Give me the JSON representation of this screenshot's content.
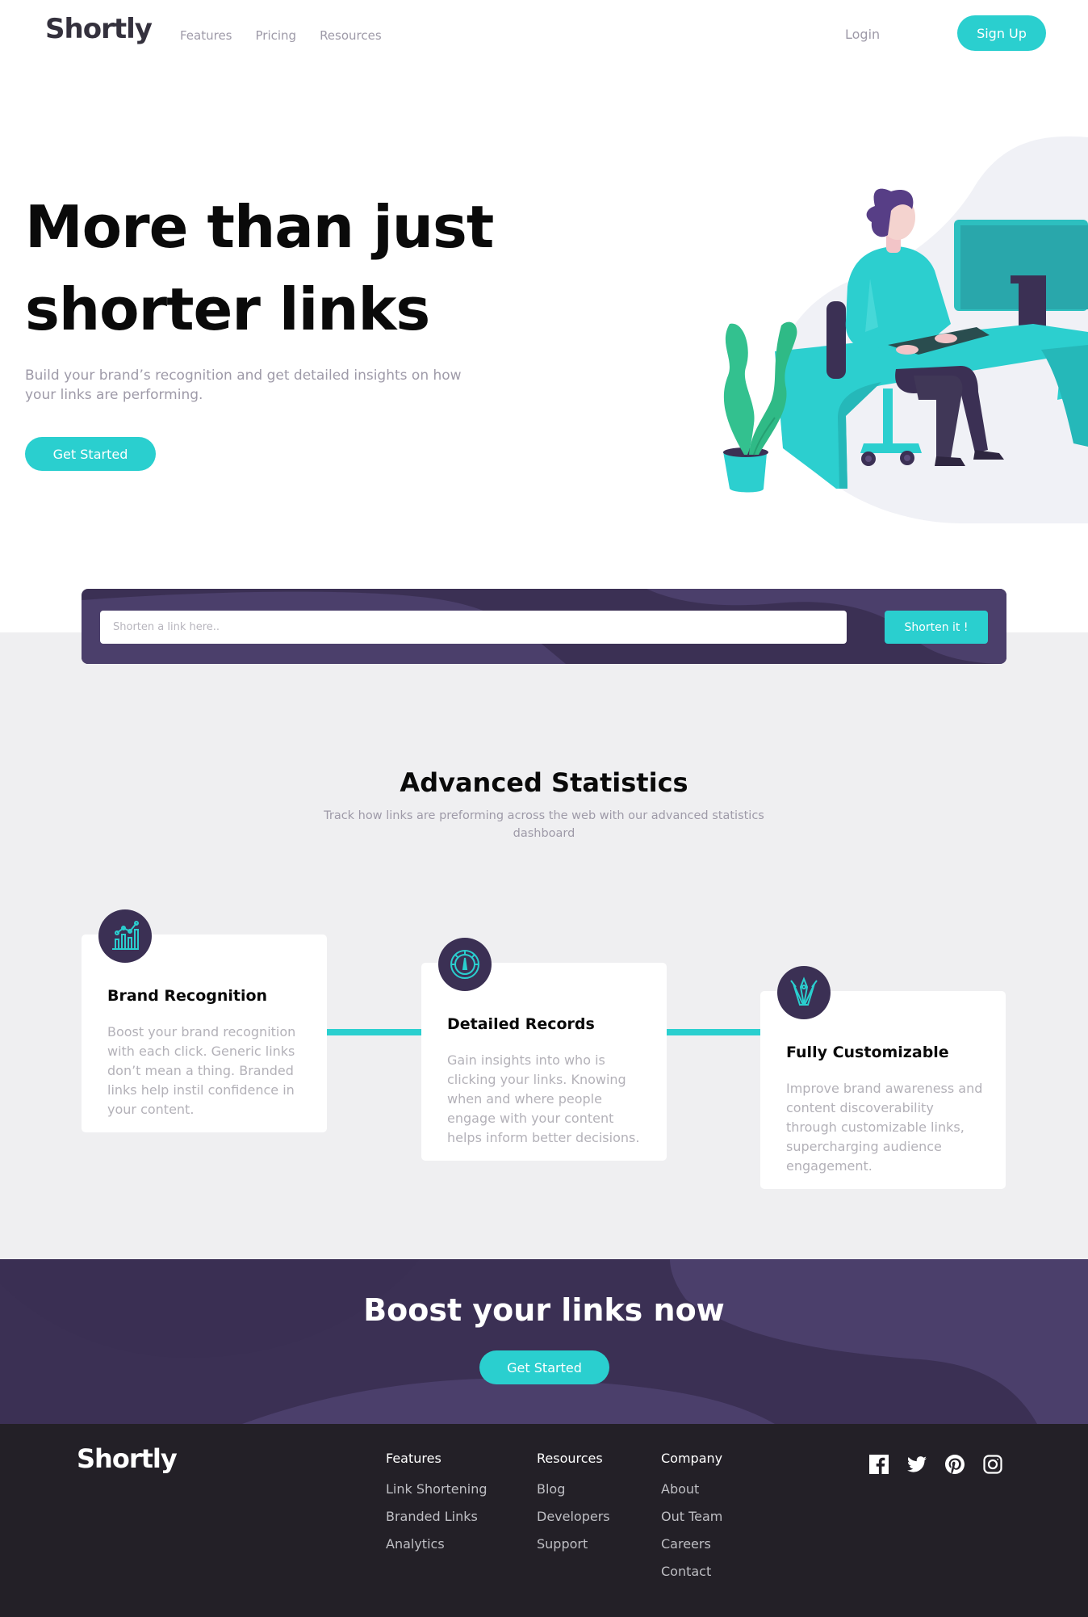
{
  "header": {
    "logo": "Shortly",
    "nav": [
      "Features",
      "Pricing",
      "Resources"
    ],
    "login": "Login",
    "signup": "Sign Up"
  },
  "hero": {
    "title": "More than just shorter links",
    "subtitle": "Build your brand’s recognition and get detailed insights on how your links are performing.",
    "cta": "Get Started"
  },
  "shorten": {
    "placeholder": "Shorten a link here..",
    "value": "",
    "button": "Shorten it !"
  },
  "stats": {
    "title": "Advanced Statistics",
    "subtitle": "Track how links are preforming across the web with our advanced statistics dashboard",
    "cards": [
      {
        "icon": "chart-icon",
        "title": "Brand Recognition",
        "text": "Boost your brand recognition with each click. Generic links don’t mean a thing. Branded links help instil confidence in your content."
      },
      {
        "icon": "gauge-icon",
        "title": "Detailed Records",
        "text": "Gain insights into who is clicking your links. Knowing when and where people engage with your content helps inform better decisions."
      },
      {
        "icon": "pens-icon",
        "title": "Fully Customizable",
        "text": "Improve brand awareness and content discoverability through customizable links, supercharging audience engagement."
      }
    ]
  },
  "boost": {
    "title": "Boost your links now",
    "cta": "Get Started"
  },
  "footer": {
    "logo": "Shortly",
    "columns": [
      {
        "heading": "Features",
        "links": [
          "Link Shortening",
          "Branded Links",
          "Analytics"
        ]
      },
      {
        "heading": "Resources",
        "links": [
          "Blog",
          "Developers",
          "Support"
        ]
      },
      {
        "heading": "Company",
        "links": [
          "About",
          "Out Team",
          "Careers",
          "Contact"
        ]
      }
    ],
    "socials": [
      "facebook-icon",
      "twitter-icon",
      "pinterest-icon",
      "instagram-icon"
    ]
  },
  "colors": {
    "cyan": "#2acfcf",
    "dark_violet": "#3b3054",
    "very_dark_violet": "#232027",
    "gray": "#9e9aa8",
    "background_gray": "#efeff1"
  }
}
